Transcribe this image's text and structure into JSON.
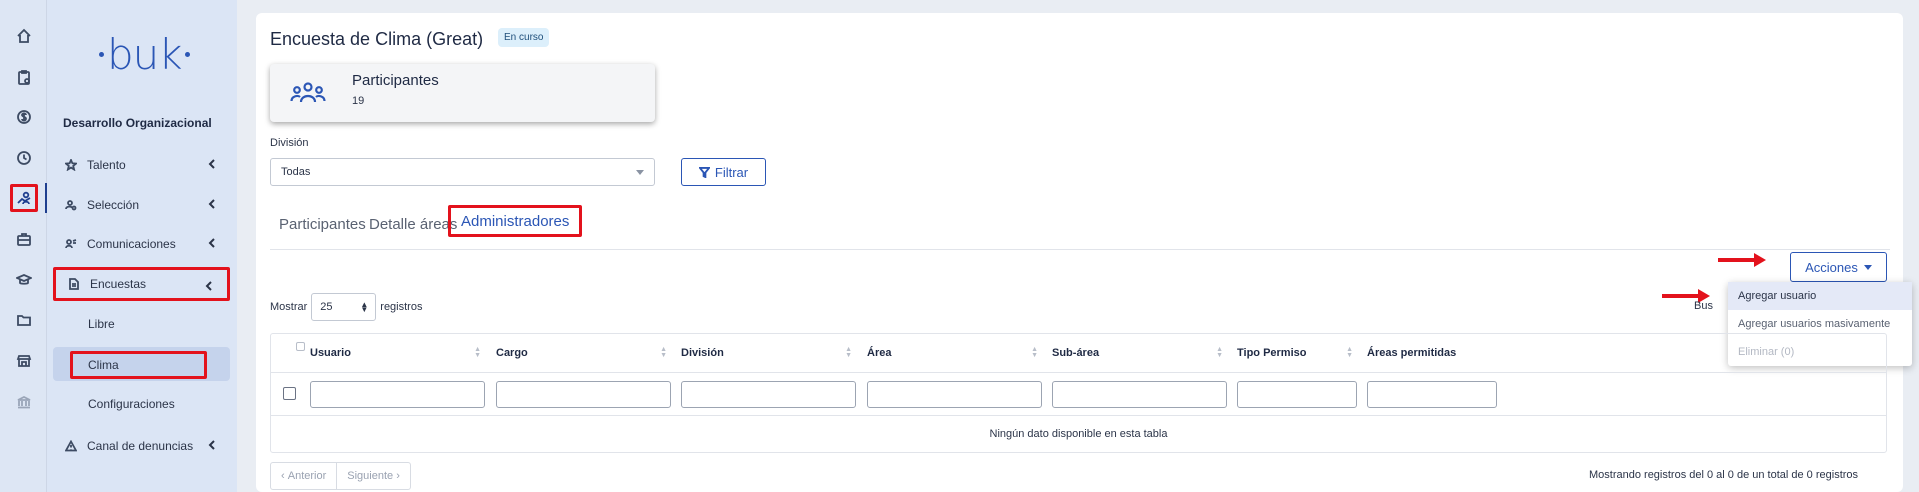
{
  "rail": {
    "items": [
      "home-icon",
      "clipboard-icon",
      "dollar-icon",
      "clock-icon",
      "people-icon",
      "briefcase-icon",
      "graduation-cap-icon",
      "folder-icon",
      "store-icon",
      "bank-icon"
    ]
  },
  "menu": {
    "logo": "buk",
    "section": "Desarrollo Organizacional",
    "items": [
      {
        "label": "Talento",
        "icon": "star-icon"
      },
      {
        "label": "Selección",
        "icon": "user-search-icon"
      },
      {
        "label": "Comunicaciones",
        "icon": "megaphone-icon"
      },
      {
        "label": "Encuestas",
        "icon": "document-icon"
      },
      {
        "label": "Canal de denuncias",
        "icon": "warning-icon"
      }
    ],
    "subitems": [
      "Libre",
      "Clima",
      "Configuraciones"
    ]
  },
  "page": {
    "title": "Encuesta de Clima (Great)",
    "status": "En curso"
  },
  "stat": {
    "title": "Participantes",
    "value": "19"
  },
  "filter": {
    "label": "División",
    "value": "Todas",
    "button": "Filtrar"
  },
  "tabs": [
    "Participantes",
    "Detalle áreas",
    "Administradores"
  ],
  "actions": {
    "label": "Acciones",
    "menu": [
      "Agregar usuario",
      "Agregar usuarios masivamente",
      "Eliminar (0)"
    ]
  },
  "table": {
    "show_prefix": "Mostrar",
    "show_value": "25",
    "show_suffix": "registros",
    "search_label": "Bus",
    "columns": [
      "Usuario",
      "Cargo",
      "División",
      "Área",
      "Sub-área",
      "Tipo Permiso",
      "Áreas permitidas"
    ],
    "empty": "Ningún dato disponible en esta tabla",
    "prev": "Anterior",
    "next": "Siguiente",
    "info": "Mostrando registros del 0 al 0 de un total de 0 registros"
  },
  "colors": {
    "accent": "#2b56b5",
    "highlight": "#e3121c",
    "sidebar": "#dbe5f5"
  }
}
